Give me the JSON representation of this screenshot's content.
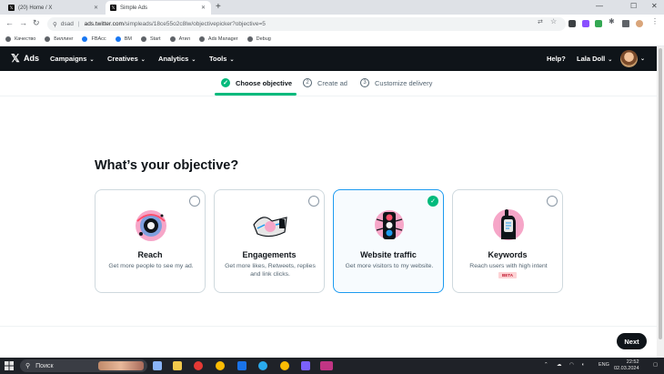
{
  "browser": {
    "tabs": [
      {
        "title": "(20) Home / X",
        "favicon": "x-logo-icon",
        "active": false
      },
      {
        "title": "Simple Ads",
        "favicon": "x-logo-icon",
        "active": true
      }
    ],
    "new_tab": "+",
    "url_prefix": "dsad",
    "url_host": "ads.twitter.com",
    "url_path": "/simpleads/18ce55o2c8lw/objectivepicker?objective=5",
    "bookmarks": [
      "Качество",
      "Биллинг",
      "FBAcc",
      "BM",
      "Start",
      "Атил",
      "Ads Manager",
      "Debug"
    ]
  },
  "header": {
    "brand": "Ads",
    "nav": [
      "Campaigns",
      "Creatives",
      "Analytics",
      "Tools"
    ],
    "help": "Help?",
    "user": "Lala Doll"
  },
  "stepper": {
    "steps": [
      {
        "num": "",
        "label": "Choose objective",
        "state": "done"
      },
      {
        "num": "2",
        "label": "Create ad",
        "state": "todo"
      },
      {
        "num": "3",
        "label": "Customize delivery",
        "state": "todo"
      }
    ]
  },
  "main": {
    "title": "What’s your objective?",
    "cards": [
      {
        "title": "Reach",
        "desc": "Get more people to see my ad.",
        "selected": false,
        "icon": "reach-illustration-icon"
      },
      {
        "title": "Engagements",
        "desc": "Get more likes, Retweets, replies and link clicks.",
        "selected": false,
        "icon": "engagements-illustration-icon"
      },
      {
        "title": "Website traffic",
        "desc": "Get more visitors to my website.",
        "selected": true,
        "icon": "website-traffic-illustration-icon"
      },
      {
        "title": "Keywords",
        "desc": "Reach users with high intent",
        "badge": "BETA",
        "selected": false,
        "icon": "keywords-illustration-icon"
      }
    ],
    "next_label": "Next"
  },
  "taskbar": {
    "search_placeholder": "Поиск",
    "lang": "ENG",
    "time": "22:52",
    "date": "02.03.2024"
  },
  "colors": {
    "accent_green": "#00ba7c",
    "selected_border": "#1d9bf0",
    "header_bg": "#0f1419"
  }
}
